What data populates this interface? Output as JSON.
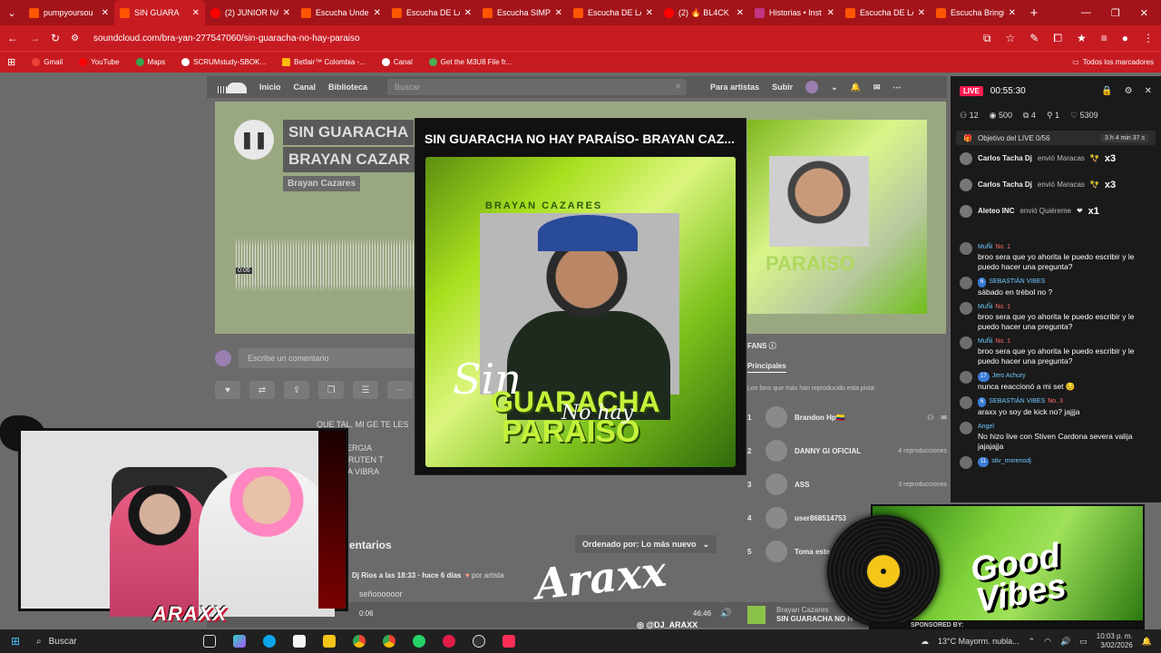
{
  "browser": {
    "tabs": [
      {
        "label": "pumpyoursou",
        "favicon": "soundcloud-icon"
      },
      {
        "label": "SIN GUARA",
        "favicon": "soundcloud-icon",
        "active": true
      },
      {
        "label": "(2) JUNIOR NA",
        "favicon": "youtube-icon"
      },
      {
        "label": "Escucha Under",
        "favicon": "soundcloud-icon"
      },
      {
        "label": "Escucha DE LA",
        "favicon": "soundcloud-icon"
      },
      {
        "label": "Escucha SIMPL",
        "favicon": "soundcloud-icon"
      },
      {
        "label": "Escucha DE LA",
        "favicon": "soundcloud-icon"
      },
      {
        "label": "(2) 🔥 BL4CK",
        "favicon": "youtube-icon"
      },
      {
        "label": "Historias • Inst",
        "favicon": "instagram-icon"
      },
      {
        "label": "Escucha DE LA",
        "favicon": "soundcloud-icon"
      },
      {
        "label": "Escucha Bringi",
        "favicon": "soundcloud-icon"
      }
    ],
    "url": "soundcloud.com/bra-yan-277547060/sin-guaracha-no-hay-paraiso",
    "bookmarks": [
      "Gmail",
      "YouTube",
      "Maps",
      "SCRUMstudy-SBOK...",
      "Betfair™ Colombia -...",
      "Canal",
      "Get the M3U8 File fr..."
    ],
    "all_bookmarks": "Todos los marcadores"
  },
  "soundcloud": {
    "nav": [
      "Inicio",
      "Canal",
      "Biblioteca"
    ],
    "search_placeholder": "Buscar",
    "right_links": [
      "Para artistas",
      "Subir"
    ],
    "track_title_1": "SIN GUARACHA",
    "track_title_2": "BRAYAN CAZAR",
    "artist": "Brayan Cazares",
    "wave_time": "0:06",
    "comment_placeholder": "Escribe un comentario",
    "description": "QUE TAL, MI GE TE LES PA\nJOR ENERGIA \nLO DISFRUTEN T\nU BUENA VIBRA\n\nmás",
    "comments_heading": "entarios",
    "sort_label": "Ordenado por: Lo más nuevo",
    "comment_meta": "Dj Rios a las 18:33 · hace 6 días",
    "comment_by": "por artista",
    "comment_text": "señoooooor",
    "fans_heading": "FANS",
    "fans_tab": "Principales",
    "fans_sub": "Los fans que más han reproducido esta pista:",
    "fans": [
      {
        "rank": "1",
        "name": "Brandon Hp🇨🇴",
        "plays": ""
      },
      {
        "rank": "2",
        "name": "DANNY GI OFICIAL",
        "plays": "4 reproducciones"
      },
      {
        "rank": "3",
        "name": "ASS",
        "plays": "3 reproducciones"
      },
      {
        "rank": "4",
        "name": "user868514753",
        "plays": ""
      },
      {
        "rank": "5",
        "name": "Toma este li",
        "plays": ""
      }
    ],
    "player": {
      "current": "0:06",
      "total": "46:46",
      "artist": "Brayan Cazares",
      "title": "SIN GUARACHA NO H"
    }
  },
  "popup": {
    "title": "SIN GUARACHA NO HAY PARAÍSO- BRAYAN CAZ...",
    "art_artist": "BRAYAN CAZARES",
    "art_sin": "Sin",
    "art_guaracha": "GUARACHA",
    "art_nohay": "No hay",
    "art_paraiso": "PARAISO"
  },
  "live": {
    "badge": "LIVE",
    "time": "00:55:30",
    "stats": {
      "viewers": "12",
      "views": "500",
      "shares": "4",
      "followers": "1",
      "likes": "5309"
    },
    "goal": "Objetivo del LIVE 0/56",
    "goal_time": "3 h 4 min 37 s",
    "gifts": [
      {
        "user": "Carlos Tacha Dj",
        "action": "envió Maracas",
        "qty": "x3"
      },
      {
        "user": "Carlos Tacha Dj",
        "action": "envió Maracas",
        "qty": "x3"
      },
      {
        "user": "Aleteo INC",
        "action": "envió Quiéreme",
        "qty": "x1"
      }
    ],
    "messages": [
      {
        "user": "MuÑi",
        "rank": "No. 1",
        "badge": "",
        "text": "broo sera que yo ahorita le puedo escribir y le puedo hacer una pregunta?"
      },
      {
        "user": "SEBASTIÁN VIBES",
        "rank": "",
        "badge": "6",
        "text": "sábado en trébol no ?"
      },
      {
        "user": "MuÑi",
        "rank": "No. 1",
        "badge": "",
        "text": "broo sera que yo ahorita le puedo escribir y le puedo hacer una pregunta?"
      },
      {
        "user": "MuÑi",
        "rank": "No. 1",
        "badge": "",
        "text": "broo sera que yo ahorita le puedo escribir y le puedo hacer una pregunta?"
      },
      {
        "user": "Jero Achury",
        "rank": "",
        "badge": "17",
        "text": "nunca reaccionó a mi set 😔"
      },
      {
        "user": "SEBASTIÁN VIBES",
        "rank": "No. 3",
        "badge": "6",
        "text": "araxx yo soy de kick no? jajjja"
      },
      {
        "user": "Angel",
        "rank": "",
        "badge": "",
        "text": "No hizo live con Stiven Cardona severa valija jajajajja"
      },
      {
        "user": "stiv_morenodj",
        "rank": "",
        "badge": "11",
        "text": ""
      }
    ]
  },
  "stream": {
    "logo": "ARAXX",
    "signature": "Araxx",
    "handle": "@DJ_ARAXX",
    "good_vibes": "Good Vibes",
    "sponsor": "SPONSORED BY:"
  },
  "taskbar": {
    "search": "Buscar",
    "weather": "13°C  Mayorm. nubla...",
    "time": "10:03 p. m.",
    "date": "3/02/2026",
    "badge": "99+"
  },
  "colors": {
    "chrome": "#c71b22",
    "tabbar": "#a3141a",
    "live_badge": "#ff1a4f",
    "lime": "#a8e01f"
  }
}
